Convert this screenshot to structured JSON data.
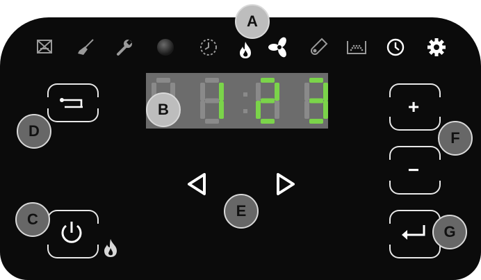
{
  "display": {
    "digits": [
      "8",
      "1",
      "2",
      "3"
    ],
    "colon": ":",
    "lit_color": "#7bd44a",
    "dim_color": "#8a8a8a"
  },
  "buttons": {
    "plus_label": "+",
    "minus_label": "−"
  },
  "callouts": {
    "a": "A",
    "b": "B",
    "c": "C",
    "d": "D",
    "e": "E",
    "f": "F",
    "g": "G"
  },
  "icons": {
    "top_row": [
      "defrost-icon",
      "clean-icon",
      "service-wrench-icon",
      "indicator-light",
      "timer-icon",
      "flame-icon",
      "fan-icon",
      "thermometer-icon",
      "tray-icon",
      "clock-icon",
      "settings-gear-icon"
    ],
    "left_buttons": [
      "back-icon",
      "power-icon"
    ],
    "right_buttons": [
      "plus",
      "minus",
      "enter-icon"
    ],
    "nav": [
      "arrow-left-icon",
      "arrow-right-icon"
    ]
  },
  "colors": {
    "panel": "#0b0b0b",
    "icon": "#9a9a9a",
    "active_icon": "#ffffff",
    "callout": "#676767"
  }
}
